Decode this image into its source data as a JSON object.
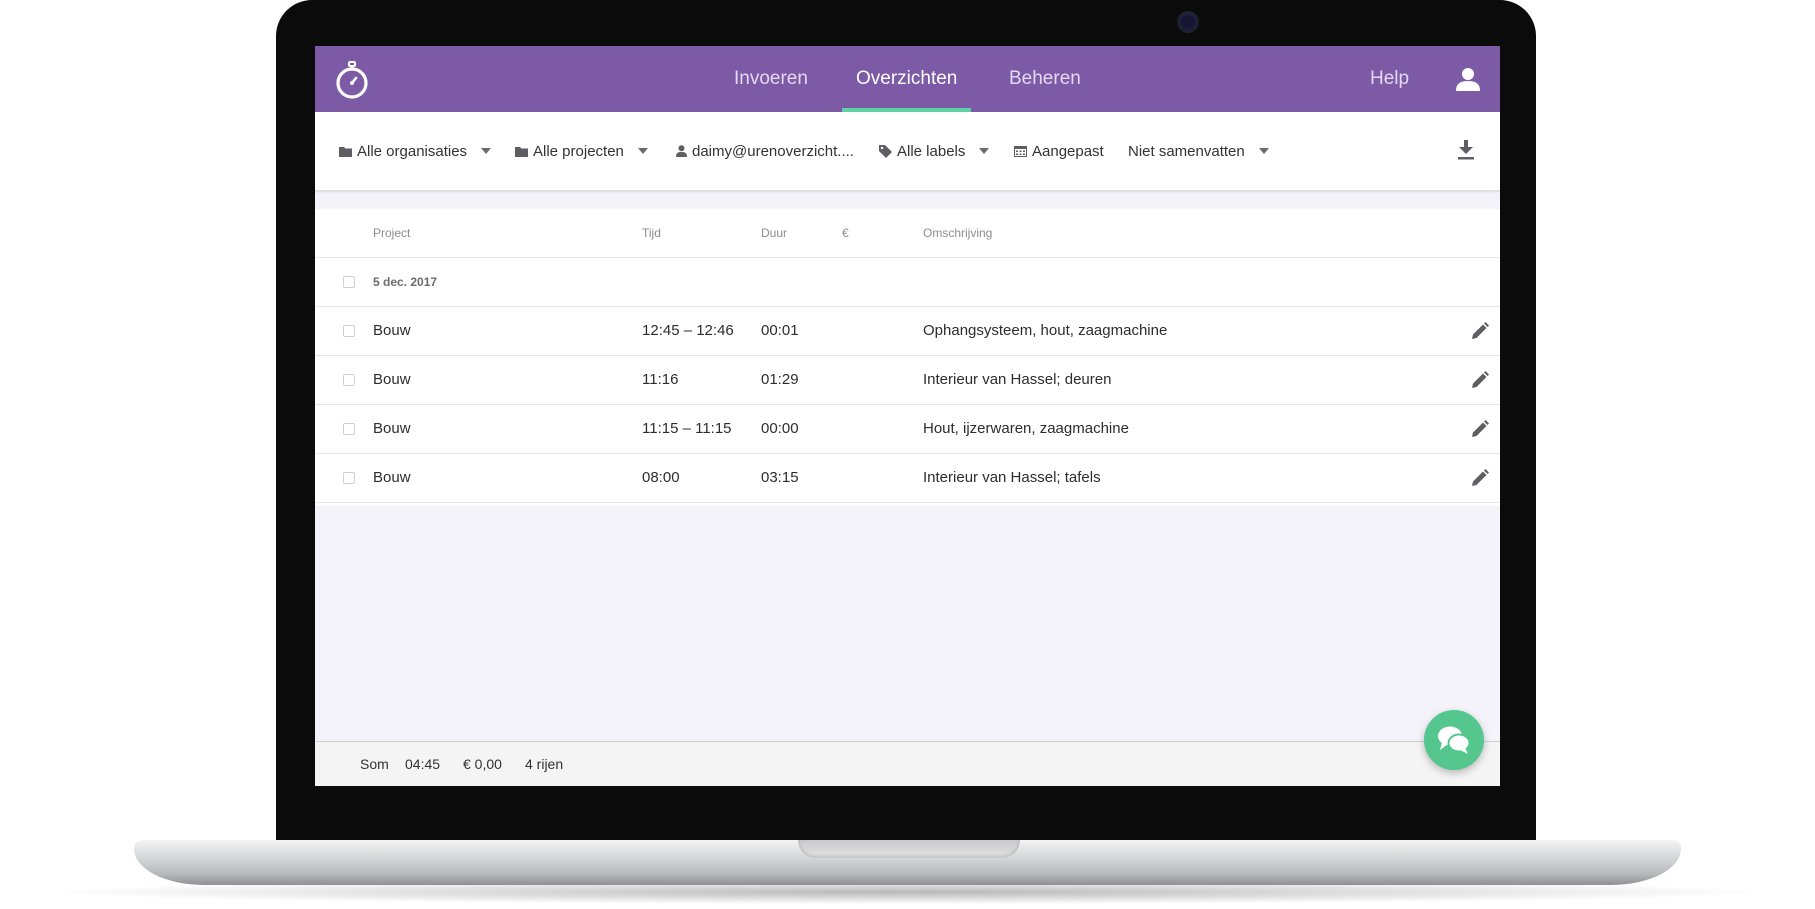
{
  "app": {
    "nav_tabs": [
      {
        "label": "Invoeren",
        "active": false
      },
      {
        "label": "Overzichten",
        "active": true
      },
      {
        "label": "Beheren",
        "active": false
      }
    ],
    "help_label": "Help",
    "accent_color": "#7d5aa5",
    "active_tab_underline_color": "#5fd1a4"
  },
  "filters": {
    "organisations": "Alle organisaties",
    "projects": "Alle projecten",
    "user": "daimy@urenoverzicht....",
    "labels": "Alle labels",
    "period": "Aangepast",
    "summarize": "Niet samenvatten"
  },
  "table": {
    "columns": {
      "project": "Project",
      "time": "Tijd",
      "duration": "Duur",
      "amount": "€",
      "description": "Omschrijving"
    },
    "date_group": "5 dec. 2017",
    "rows": [
      {
        "project": "Bouw",
        "time": "12:45 – 12:46",
        "duration": "00:01",
        "amount": "",
        "description": "Ophangsysteem, hout, zaagmachine"
      },
      {
        "project": "Bouw",
        "time": "11:16",
        "duration": "01:29",
        "amount": "",
        "description": "Interieur van Hassel; deuren"
      },
      {
        "project": "Bouw",
        "time": "11:15 – 11:15",
        "duration": "00:00",
        "amount": "",
        "description": "Hout, ijzerwaren, zaagmachine"
      },
      {
        "project": "Bouw",
        "time": "08:00",
        "duration": "03:15",
        "amount": "",
        "description": "Interieur van Hassel; tafels"
      }
    ]
  },
  "footer": {
    "sum_label": "Som",
    "total_duration": "04:45",
    "total_amount": "€ 0,00",
    "row_count": "4 rijen"
  },
  "icons": {
    "logo": "stopwatch-icon",
    "user": "user-icon",
    "folder": "folder-icon",
    "person": "person-icon",
    "tag": "tag-icon",
    "calendar": "calendar-icon",
    "download": "download-icon",
    "edit": "pencil-icon",
    "chat": "chat-icon"
  },
  "chat_button_color": "#55c68e"
}
